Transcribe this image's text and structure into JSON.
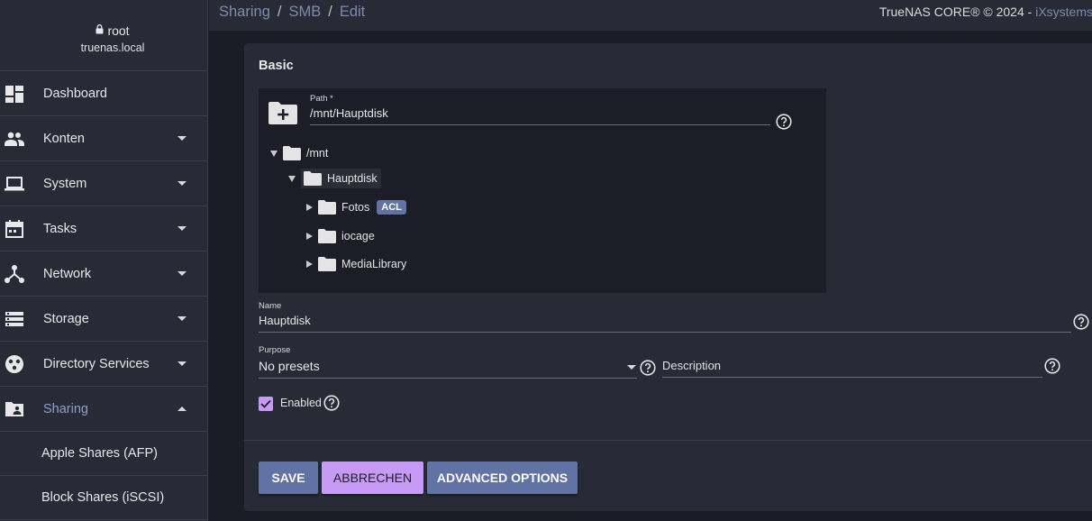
{
  "user": {
    "name": "root",
    "host": "truenas.local"
  },
  "sidebar": {
    "items": [
      {
        "label": "Dashboard",
        "icon": "dashboard-icon",
        "expandable": false
      },
      {
        "label": "Konten",
        "icon": "people-icon",
        "expandable": true
      },
      {
        "label": "System",
        "icon": "laptop-icon",
        "expandable": true
      },
      {
        "label": "Tasks",
        "icon": "calendar-icon",
        "expandable": true
      },
      {
        "label": "Network",
        "icon": "network-icon",
        "expandable": true
      },
      {
        "label": "Storage",
        "icon": "storage-icon",
        "expandable": true
      },
      {
        "label": "Directory Services",
        "icon": "directory-icon",
        "expandable": true
      },
      {
        "label": "Sharing",
        "icon": "folder-shared-icon",
        "expandable": true,
        "expanded": true,
        "active": true
      }
    ],
    "sub_items": [
      {
        "label": "Apple Shares (AFP)"
      },
      {
        "label": "Block Shares (iSCSI)"
      }
    ]
  },
  "breadcrumb": {
    "items": [
      "Sharing",
      "SMB",
      "Edit"
    ],
    "separator": "/"
  },
  "brand": {
    "text": "TrueNAS CORE® © 2024 - ",
    "link": "iXsystems"
  },
  "form": {
    "section_title": "Basic",
    "path": {
      "label": "Path *",
      "value": "/mnt/Hauptdisk"
    },
    "tree": {
      "root": "/mnt",
      "selected": "Hauptdisk",
      "children": [
        {
          "label": "Fotos",
          "badge": "ACL"
        },
        {
          "label": "iocage"
        },
        {
          "label": "MediaLibrary"
        }
      ]
    },
    "name": {
      "label": "Name",
      "value": "Hauptdisk"
    },
    "purpose": {
      "label": "Purpose",
      "value": "No presets"
    },
    "description": {
      "placeholder": "Description",
      "value": ""
    },
    "enabled": {
      "label": "Enabled",
      "checked": true
    },
    "buttons": {
      "save": "SAVE",
      "cancel": "ABBRECHEN",
      "advanced": "ADVANCED OPTIONS"
    }
  },
  "colors": {
    "accent": "#6172a5",
    "checkbox": "#c69af5",
    "link": "#7d8bb0"
  }
}
